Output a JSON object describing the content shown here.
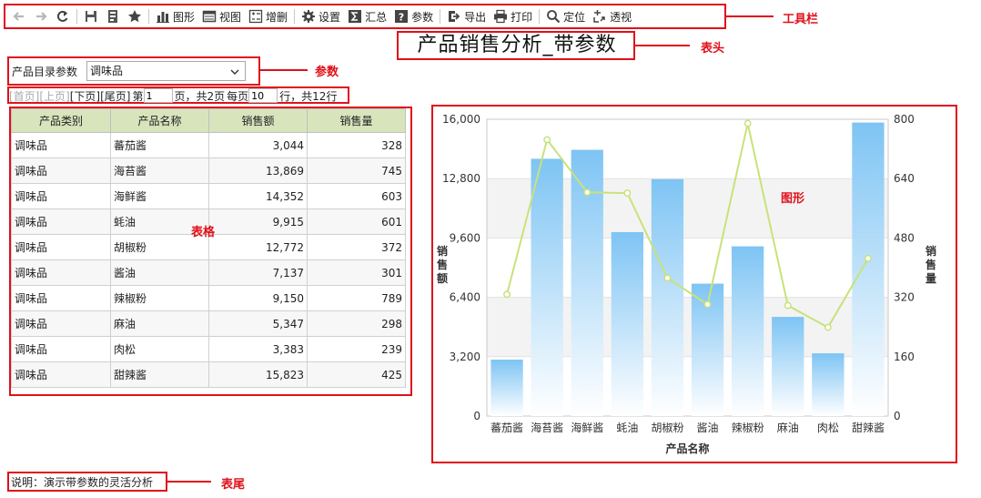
{
  "toolbar": {
    "items": [
      {
        "icon": "back-arrow-icon",
        "label": ""
      },
      {
        "icon": "forward-arrow-icon",
        "label": ""
      },
      {
        "icon": "refresh-icon",
        "label": ""
      },
      {
        "icon": "save-icon",
        "label": ""
      },
      {
        "icon": "save-as-icon",
        "label": ""
      },
      {
        "icon": "star-icon",
        "label": ""
      },
      {
        "icon": "bar-chart-icon",
        "label": "图形"
      },
      {
        "icon": "view-icon",
        "label": "视图"
      },
      {
        "icon": "add-delete-icon",
        "label": "增删"
      },
      {
        "icon": "gear-icon",
        "label": "设置"
      },
      {
        "icon": "sum-icon",
        "label": "汇总"
      },
      {
        "icon": "question-icon",
        "label": "参数"
      },
      {
        "icon": "export-icon",
        "label": "导出"
      },
      {
        "icon": "printer-icon",
        "label": "打印"
      },
      {
        "icon": "search-icon",
        "label": "定位"
      },
      {
        "icon": "pivot-icon",
        "label": "透视"
      }
    ]
  },
  "annotations": {
    "toolbar": "工具栏",
    "header": "表头",
    "param": "参数",
    "table": "表格",
    "chart": "图形",
    "footer": "表尾"
  },
  "title": "产品销售分析_带参数",
  "param": {
    "label": "产品目录参数",
    "value": "调味品"
  },
  "pager": {
    "first": "[首页]",
    "prev": "[上页]",
    "next": "[下页]",
    "last": "[尾页]",
    "page_prefix": "第",
    "page_value": "1",
    "page_suffix": "页，共2页",
    "per_prefix": "每页",
    "per_value": "10",
    "per_suffix": "行，共12行"
  },
  "table": {
    "headers": [
      "产品类别",
      "产品名称",
      "销售额",
      "销售量"
    ],
    "rows": [
      [
        "调味品",
        "蕃茄酱",
        "3,044",
        "328"
      ],
      [
        "调味品",
        "海苔酱",
        "13,869",
        "745"
      ],
      [
        "调味品",
        "海鲜酱",
        "14,352",
        "603"
      ],
      [
        "调味品",
        "蚝油",
        "9,915",
        "601"
      ],
      [
        "调味品",
        "胡椒粉",
        "12,772",
        "372"
      ],
      [
        "调味品",
        "酱油",
        "7,137",
        "301"
      ],
      [
        "调味品",
        "辣椒粉",
        "9,150",
        "789"
      ],
      [
        "调味品",
        "麻油",
        "5,347",
        "298"
      ],
      [
        "调味品",
        "肉松",
        "3,383",
        "239"
      ],
      [
        "调味品",
        "甜辣酱",
        "15,823",
        "425"
      ]
    ]
  },
  "footer": "说明：演示带参数的灵活分析",
  "colors": {
    "annotation_red": "#e0101a",
    "header_green": "#d8e4bc",
    "bar_blue": "#7ec4f4",
    "line_green": "#c8e27a"
  },
  "chart_data": {
    "type": "bar",
    "categories": [
      "蕃茄酱",
      "海苔酱",
      "海鲜酱",
      "蚝油",
      "胡椒粉",
      "酱油",
      "辣椒粉",
      "麻油",
      "肉松",
      "甜辣酱"
    ],
    "series": [
      {
        "name": "销售额",
        "type": "bar",
        "axis": "left",
        "values": [
          3044,
          13869,
          14352,
          9915,
          12772,
          7137,
          9150,
          5347,
          3383,
          15823
        ]
      },
      {
        "name": "销售量",
        "type": "line",
        "axis": "right",
        "values": [
          328,
          745,
          603,
          601,
          372,
          301,
          789,
          298,
          239,
          425
        ]
      }
    ],
    "xlabel": "产品名称",
    "ylabel": "销售额",
    "y2label": "销售量",
    "ylim": [
      0,
      16000
    ],
    "y2lim": [
      0,
      800
    ],
    "yticks": [
      "0",
      "3,200",
      "6,400",
      "9,600",
      "12,800",
      "16,000"
    ],
    "y2ticks": [
      "0",
      "160",
      "320",
      "480",
      "640",
      "800"
    ],
    "grid": true,
    "legend": "none"
  }
}
